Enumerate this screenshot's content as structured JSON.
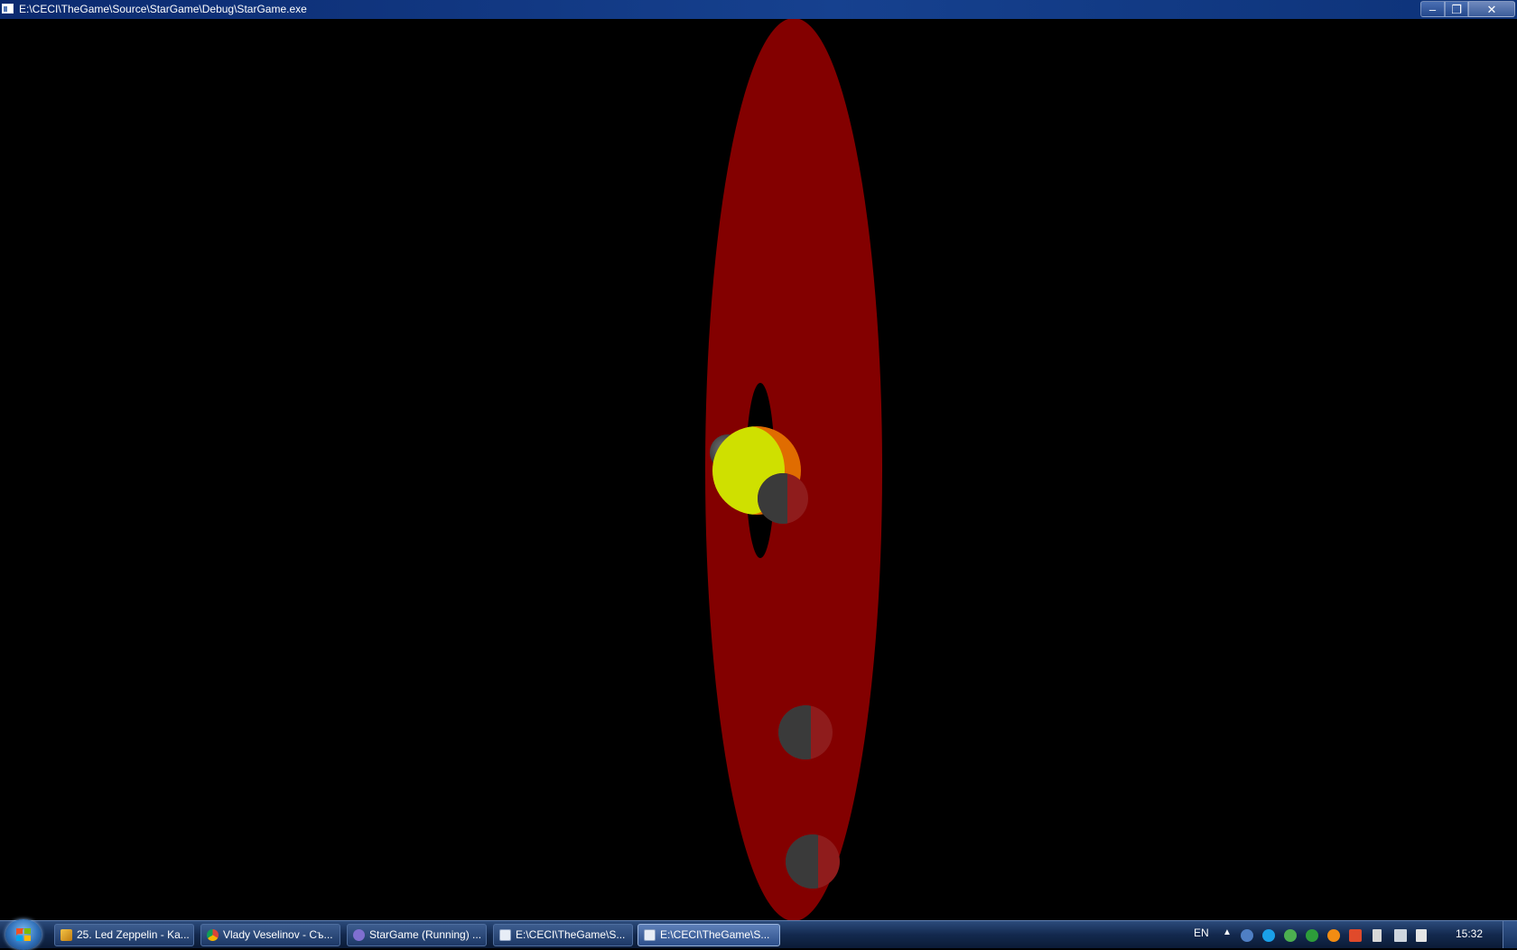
{
  "window": {
    "title": "E:\\CECI\\TheGame\\Source\\StarGame\\Debug\\StarGame.exe",
    "minimize_symbol": "–",
    "maximize_symbol": "❐",
    "close_symbol": "✕"
  },
  "scene": {
    "background_color": "#000000",
    "orbit_disc_color": "#830000",
    "star_color": "#cfe000",
    "star_edge_color": "#e06c00",
    "planet_shadow_color": "#3a3a3a",
    "planet_lit_color": "#8f1c1c"
  },
  "taskbar": {
    "start_icon": "windows-logo-icon",
    "tasks": [
      {
        "label": "25. Led Zeppelin - Ka...",
        "icon": "music-player-icon",
        "active": false
      },
      {
        "label": "Vlady Veselinov - Съ...",
        "icon": "chrome-icon",
        "active": false
      },
      {
        "label": "StarGame (Running) ...",
        "icon": "visual-studio-icon",
        "active": false
      },
      {
        "label": "E:\\CECI\\TheGame\\S...",
        "icon": "console-window-icon",
        "active": false
      },
      {
        "label": "E:\\CECI\\TheGame\\S...",
        "icon": "console-window-icon",
        "active": true
      }
    ],
    "language": "EN",
    "tray_arrow": "▲",
    "tray_icons": [
      "network-icon",
      "skype-icon",
      "utorrent-icon",
      "antivirus-icon",
      "flag-icon",
      "volume-icon"
    ],
    "clock": "15:32"
  }
}
